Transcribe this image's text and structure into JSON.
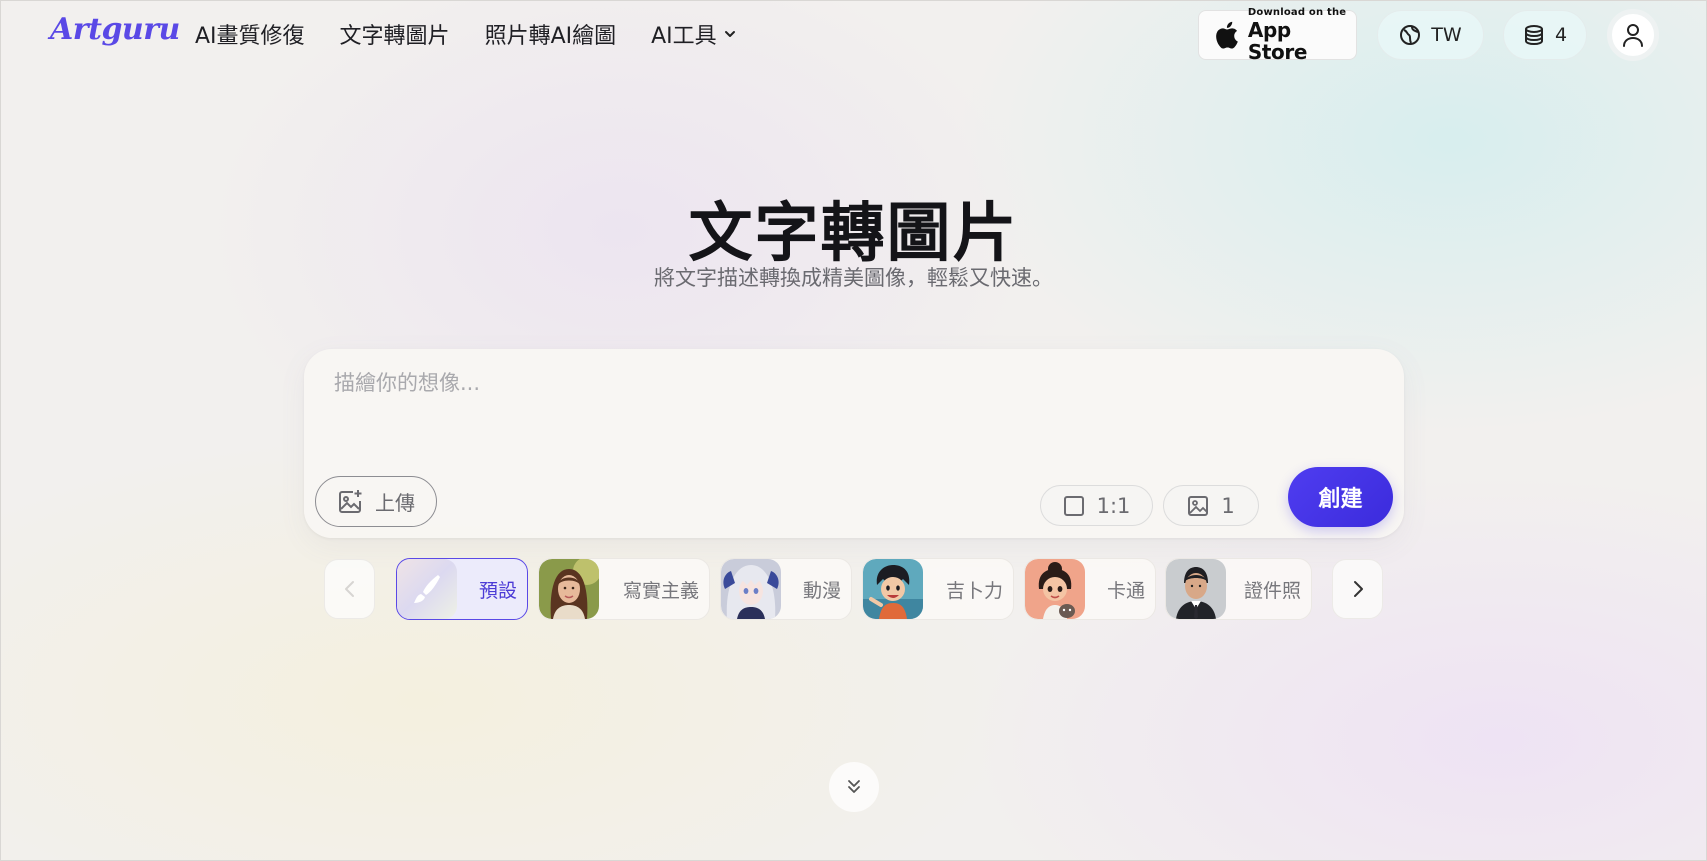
{
  "header": {
    "logo": "Artguru",
    "nav": [
      {
        "label": "AI畫質修復"
      },
      {
        "label": "文字轉圖片"
      },
      {
        "label": "照片轉AI繪圖"
      },
      {
        "label": "AI工具"
      }
    ],
    "appstore": {
      "small": "Download on the",
      "big": "App Store"
    },
    "language": "TW",
    "credits": "4"
  },
  "hero": {
    "title": "文字轉圖片",
    "subtitle": "將文字描述轉換成精美圖像，輕鬆又快速。"
  },
  "prompt": {
    "placeholder": "描繪你的想像...",
    "value": "",
    "upload_label": "上傳",
    "ratio": "1:1",
    "count": "1",
    "create_label": "創建"
  },
  "styles": {
    "selected_index": 0,
    "items": [
      {
        "label": "預設",
        "icon": "brush-icon"
      },
      {
        "label": "寫實主義",
        "icon": "portrait-woman"
      },
      {
        "label": "動漫",
        "icon": "anime-girl"
      },
      {
        "label": "吉卜力",
        "icon": "ghibli-boy"
      },
      {
        "label": "卡通",
        "icon": "cartoon-girl"
      },
      {
        "label": "證件照",
        "icon": "id-photo-man"
      }
    ]
  },
  "colors": {
    "accent": "#5a49e6",
    "create_button": "#4535e8"
  }
}
